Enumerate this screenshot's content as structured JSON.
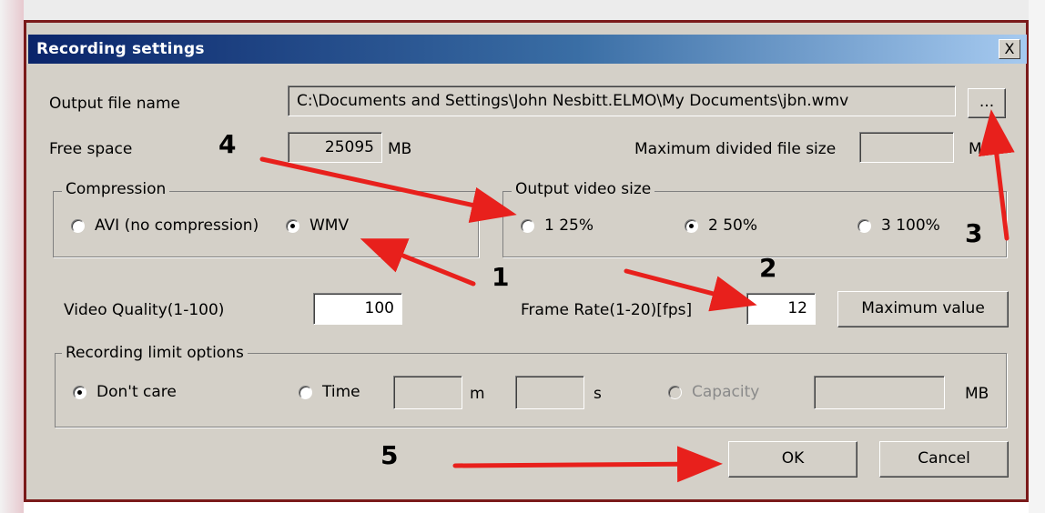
{
  "dialog": {
    "title": "Recording settings",
    "close_label": "X",
    "output_file_label": "Output file name",
    "output_file_value": "C:\\Documents and Settings\\John Nesbitt.ELMO\\My Documents\\jbn.wmv",
    "browse_label": "...",
    "free_space_label": "Free space",
    "free_space_value": "25095",
    "free_space_unit": "MB",
    "max_divided_label": "Maximum divided file size",
    "max_divided_value": "",
    "max_divided_unit": "MB"
  },
  "compression": {
    "legend": "Compression",
    "options": [
      {
        "label": "AVI (no compression)",
        "selected": false
      },
      {
        "label": "WMV",
        "selected": true
      }
    ]
  },
  "output_video_size": {
    "legend": "Output video size",
    "options": [
      {
        "label": "1  25%",
        "selected": false
      },
      {
        "label": "2  50%",
        "selected": true
      },
      {
        "label": "3  100%",
        "selected": false
      }
    ]
  },
  "quality": {
    "video_quality_label": "Video Quality(1-100)",
    "video_quality_value": "100",
    "frame_rate_label": "Frame Rate(1-20)[fps]",
    "frame_rate_value": "12",
    "max_value_button": "Maximum value"
  },
  "recording_limit": {
    "legend": "Recording limit options",
    "dont_care_label": "Don't care",
    "time_label": "Time",
    "minutes_value": "",
    "minutes_unit": "m",
    "seconds_value": "",
    "seconds_unit": "s",
    "capacity_label": "Capacity",
    "capacity_value": "",
    "capacity_unit": "MB",
    "selected": "Don't care"
  },
  "buttons": {
    "ok": "OK",
    "cancel": "Cancel"
  },
  "annotations": {
    "marker_1": "1",
    "marker_2": "2",
    "marker_3": "3",
    "marker_4": "4",
    "marker_5": "5",
    "arrow_color": "#e8201c"
  },
  "colors": {
    "dialog_face": "#d4d0c8",
    "titlebar_start": "#0a246a",
    "titlebar_end": "#a6caf0"
  }
}
